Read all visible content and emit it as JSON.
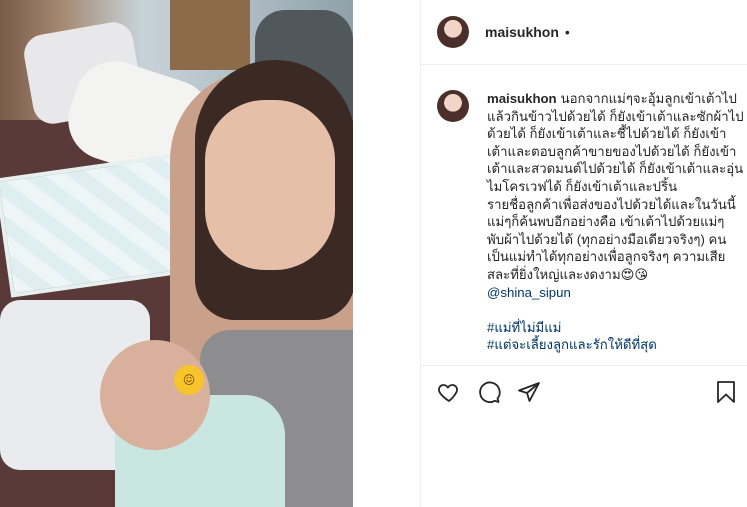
{
  "post": {
    "username": "maisukhon",
    "header_separator": "•"
  },
  "caption": {
    "username": "maisukhon",
    "lines": [
      "นอกจากแม่ๆจะอุ้มลูกเข้าเต้าไป",
      "แล้วกินข้าวไปด้วยได้ ก็ยังเข้าเต้าและซักผ้าไป",
      "ด้วยได้ ก็ยังเข้าเต้าและชี้ไปด้วยได้ ก็ยังเข้า",
      "เต้าและตอบลูกค้าขายของไปด้วยได้ ก็ยังเข้า",
      "เต้าและสวดมนต์ไปด้วยได้ ก็ยังเข้าเต้าและอุ่น",
      "ไมโครเวฟได้ ก็ยังเข้าเต้าและปริ้น",
      "รายชื่อลูกค้าเพื่อส่งของไปด้วยได้และในวันนี้",
      "แม่ๆก็ค้นพบอีกอย่างคือ เข้าเต้าไปด้วยแม่ๆ",
      "พับผ้าไปด้วยได้ (ทุกอย่างมือเดียวจริงๆ) คน",
      "เป็นแม่ทำได้ทุกอย่างเพื่อลูกจริงๆ ความเสีย",
      "สละที่ยิ่งใหญ่และงดงาม😍😘"
    ],
    "mention": "@shina_sipun",
    "hashtags": [
      "#แม่ที่ไม่มีแม่",
      "#แต่จะเลี้ยงลูกและรักให้ดีที่สุด"
    ]
  },
  "photo": {
    "emoji": "😖"
  },
  "icons": {
    "like": "heart-icon",
    "comment": "comment-icon",
    "share": "share-icon",
    "save": "bookmark-icon"
  },
  "colors": {
    "text": "#262626",
    "link": "#00376b",
    "divider": "#efefef"
  }
}
